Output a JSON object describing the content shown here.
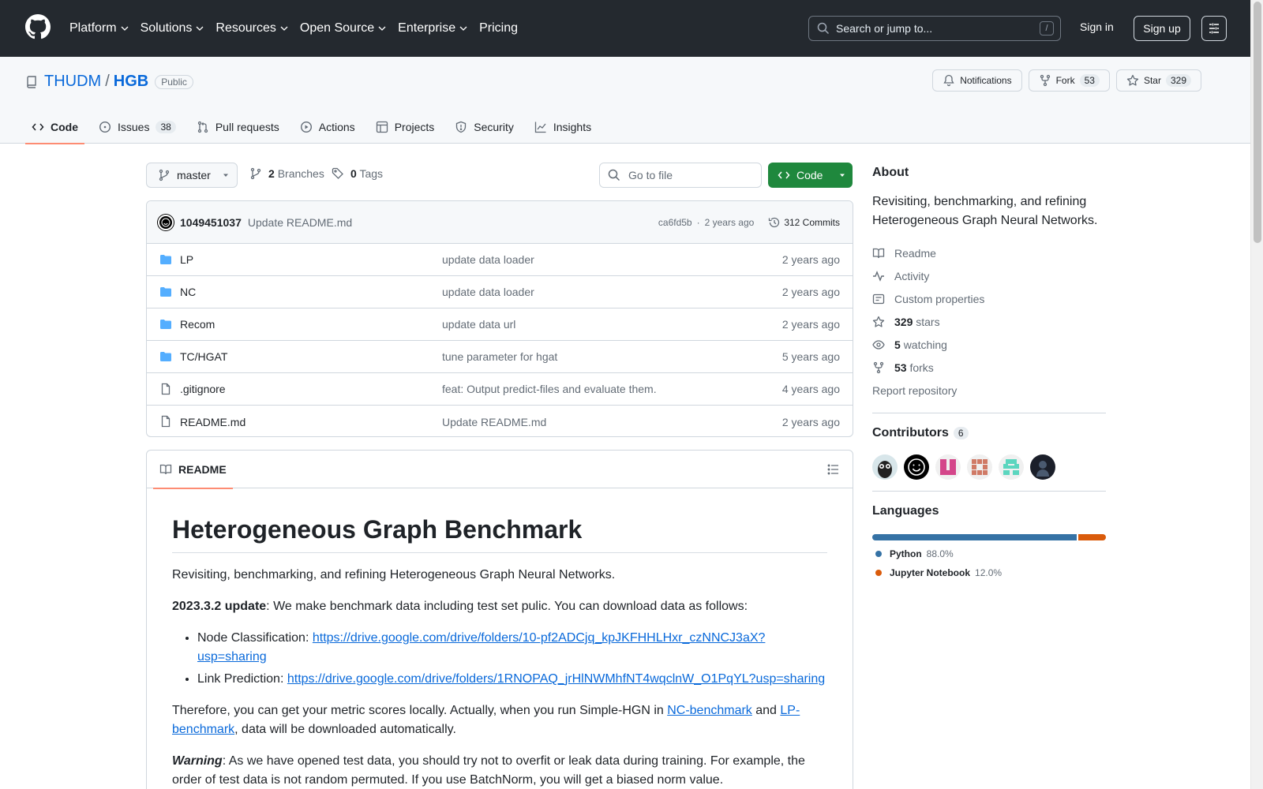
{
  "header": {
    "nav": [
      "Platform",
      "Solutions",
      "Resources",
      "Open Source",
      "Enterprise",
      "Pricing"
    ],
    "search_placeholder": "Search or jump to...",
    "search_shortcut": "/",
    "sign_in": "Sign in",
    "sign_up": "Sign up"
  },
  "repo": {
    "owner": "THUDM",
    "name": "HGB",
    "visibility": "Public",
    "notifications_label": "Notifications",
    "fork_label": "Fork",
    "fork_count": "53",
    "star_label": "Star",
    "star_count": "329"
  },
  "tabs": {
    "code": "Code",
    "issues": "Issues",
    "issues_count": "38",
    "pulls": "Pull requests",
    "actions": "Actions",
    "projects": "Projects",
    "security": "Security",
    "insights": "Insights"
  },
  "toolbar": {
    "branch": "master",
    "branches_count": "2",
    "branches_label": "Branches",
    "tags_count": "0",
    "tags_label": "Tags",
    "goto_placeholder": "Go to file",
    "code_label": "Code"
  },
  "latest_commit": {
    "author": "1049451037",
    "message": "Update README.md",
    "sha": "ca6fd5b",
    "time": "2 years ago",
    "commits_label": "312 Commits"
  },
  "files": [
    {
      "type": "dir",
      "name": "LP",
      "message": "update data loader",
      "time": "2 years ago"
    },
    {
      "type": "dir",
      "name": "NC",
      "message": "update data loader",
      "time": "2 years ago"
    },
    {
      "type": "dir",
      "name": "Recom",
      "message": "update data url",
      "time": "2 years ago"
    },
    {
      "type": "dir",
      "name": "TC/HGAT",
      "message": "tune parameter for hgat",
      "time": "5 years ago"
    },
    {
      "type": "file",
      "name": ".gitignore",
      "message": "feat: Output predict-files and evaluate them.",
      "time": "4 years ago"
    },
    {
      "type": "file",
      "name": "README.md",
      "message": "Update README.md",
      "time": "2 years ago"
    }
  ],
  "readme": {
    "tab_label": "README",
    "title": "Heterogeneous Graph Benchmark",
    "intro": "Revisiting, benchmarking, and refining Heterogeneous Graph Neural Networks.",
    "update_bold": "2023.3.2 update",
    "update_text": ": We make benchmark data including test set pulic. You can download data as follows:",
    "nc_label": "Node Classification: ",
    "nc_link": "https://drive.google.com/drive/folders/10-pf2ADCjq_kpJKFHHLHxr_czNNCJ3aX?usp=sharing",
    "lp_label": "Link Prediction: ",
    "lp_link": "https://drive.google.com/drive/folders/1RNOPAQ_jrHlNWMhfNT4wqclnW_O1PqYL?usp=sharing",
    "therefore_1": "Therefore, you can get your metric scores locally. Actually, when you run Simple-HGN in ",
    "nc_bench": "NC-benchmark",
    "and": " and ",
    "lp_bench": "LP-benchmark",
    "therefore_2": ", data will be downloaded automatically.",
    "warning_bold": "Warning",
    "warning_text": ": As we have opened test data, you should try not to overfit or leak data during training. For example, the order of test data is not random permuted. If you use BatchNorm, you will get a biased norm value."
  },
  "about": {
    "heading": "About",
    "description": "Revisiting, benchmarking, and refining Heterogeneous Graph Neural Networks.",
    "readme": "Readme",
    "activity": "Activity",
    "custom_props": "Custom properties",
    "stars_count": "329",
    "stars_label": "stars",
    "watching_count": "5",
    "watching_label": "watching",
    "forks_count": "53",
    "forks_label": "forks",
    "report": "Report repository"
  },
  "contributors": {
    "heading": "Contributors",
    "count": "6"
  },
  "languages": {
    "heading": "Languages",
    "items": [
      {
        "name": "Python",
        "pct": "88.0%",
        "value": 88.0,
        "color": "#3572A5"
      },
      {
        "name": "Jupyter Notebook",
        "pct": "12.0%",
        "value": 12.0,
        "color": "#DA5B0B"
      }
    ]
  }
}
